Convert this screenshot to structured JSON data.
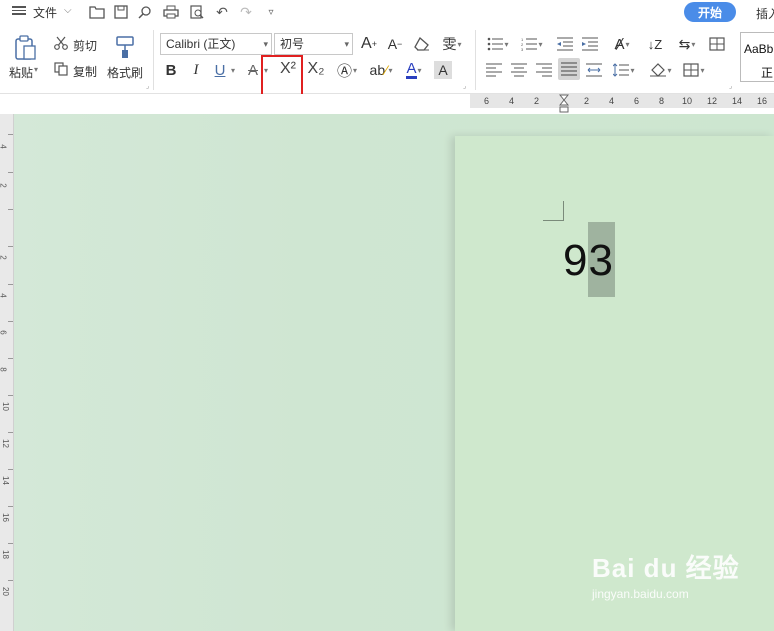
{
  "menubar": {
    "file_label": "文件",
    "tab_active": "开始",
    "tab_next": "插入"
  },
  "ribbon": {
    "paste_label": "粘贴",
    "cut_label": "剪切",
    "copy_label": "复制",
    "format_painter_label": "格式刷",
    "font_name": "Calibri (正文)",
    "font_size": "初号",
    "bold_label": "B",
    "italic_label": "I",
    "underline_label": "U",
    "superscript_label": "X²",
    "subscript_label": "X₂",
    "style_preview_top": "AaBb",
    "style_preview_bottom": "正"
  },
  "ruler": {
    "ticks": [
      "6",
      "4",
      "2",
      "2",
      "4",
      "6",
      "8",
      "10",
      "12",
      "14",
      "16"
    ],
    "vticks": [
      "4",
      "2",
      "2",
      "4",
      "6",
      "8",
      "10",
      "12",
      "14",
      "16",
      "18",
      "20"
    ]
  },
  "document": {
    "text": "93"
  },
  "watermark": {
    "line1": "Bai du 经验",
    "line2": "jingyan.baidu.com"
  },
  "colors": {
    "accent": "#4a8ce8",
    "highlight": "#e02020",
    "page_bg": "#cfe8cd",
    "selection": "#9fb39f"
  }
}
